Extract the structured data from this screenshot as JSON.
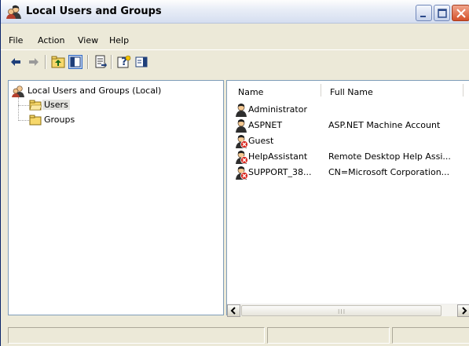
{
  "window": {
    "title": "Local Users and Groups"
  },
  "menu": {
    "items": [
      "File",
      "Action",
      "View",
      "Help"
    ]
  },
  "toolbar": {
    "icons": [
      "back-arrow-icon",
      "forward-arrow-icon",
      "up-folder-icon",
      "show-hide-tree-icon",
      "export-list-icon",
      "help-icon",
      "show-hide-action-pane-icon"
    ]
  },
  "tree": {
    "root": "Local Users and Groups (Local)",
    "children": [
      {
        "label": "Users",
        "selected": true
      },
      {
        "label": "Groups",
        "selected": false
      }
    ]
  },
  "list": {
    "columns": [
      "Name",
      "Full Name"
    ],
    "rows": [
      {
        "name": "Administrator",
        "full_name": "",
        "disabled": false
      },
      {
        "name": "ASPNET",
        "full_name": "ASP.NET Machine Account",
        "disabled": false
      },
      {
        "name": "Guest",
        "full_name": "",
        "disabled": true
      },
      {
        "name": "HelpAssistant",
        "full_name": "Remote Desktop Help Assi...",
        "disabled": true
      },
      {
        "name": "SUPPORT_38...",
        "full_name": "CN=Microsoft Corporation...",
        "disabled": true
      }
    ],
    "scroll_grip": "III"
  },
  "colors": {
    "accent": "#316ac5",
    "pane_border": "#7f9db9",
    "window_bg": "#ece9d8"
  }
}
